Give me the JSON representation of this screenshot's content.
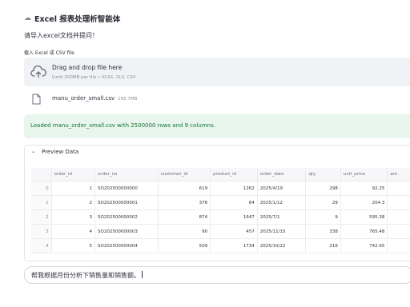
{
  "header": {
    "icon": "sparkle-icon",
    "title": "Excel 报表处理析智能体"
  },
  "prompt": "请导入excel文档并提问！",
  "uploader": {
    "label": "载入 Excel 或 CSV file",
    "drop_title": "Drag and drop file here",
    "limit": "Limit 200MB per file • XLSX, XLS, CSV",
    "icon": "cloud-upload-icon"
  },
  "file": {
    "name": "manu_order_small.csv",
    "size": "195.7MB",
    "icon": "file-icon"
  },
  "status": {
    "message": "Loaded manu_order_small.csv with 2500000 rows and 9 columns."
  },
  "preview": {
    "title": "Preview Data",
    "columns": [
      "",
      "order_id",
      "order_no",
      "customer_id",
      "product_id",
      "order_date",
      "qty",
      "unit_price",
      "am"
    ],
    "rows": [
      [
        "0",
        "1",
        "SO202500000000",
        "619",
        "1262",
        "2025/4/19",
        "298",
        "92.25",
        ""
      ],
      [
        "1",
        "2",
        "SO202500000001",
        "376",
        "64",
        "2025/1/12",
        "29",
        "204.3",
        ""
      ],
      [
        "2",
        "3",
        "SO202500000002",
        "874",
        "1647",
        "2025/7/1",
        "9",
        "595.38",
        ""
      ],
      [
        "3",
        "4",
        "SO202500000003",
        "90",
        "457",
        "2025/11/15",
        "338",
        "765.48",
        ""
      ],
      [
        "4",
        "5",
        "SO202500000004",
        "509",
        "1734",
        "2025/10/22",
        "216",
        "742.65",
        ""
      ]
    ]
  },
  "chat": {
    "value": "帮我根据月份分析下销售量和销售额。"
  },
  "colors": {
    "success_bg": "#e8f6ee",
    "success_text": "#177233",
    "dropzone_bg": "#f0f2f6"
  }
}
